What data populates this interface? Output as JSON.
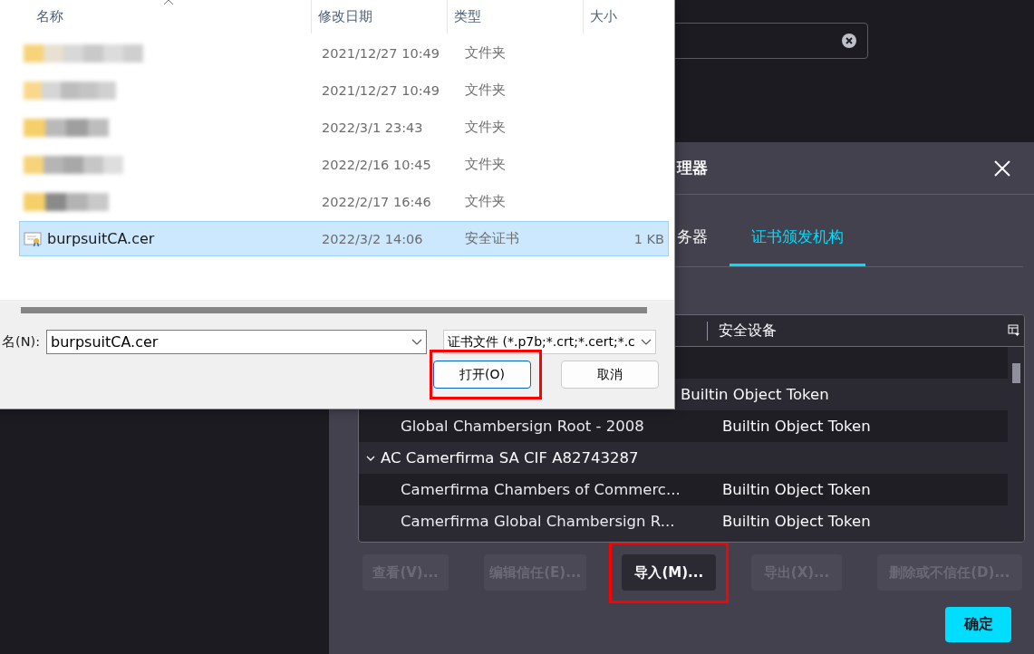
{
  "search_field": {
    "has_clear": true
  },
  "cert_manager": {
    "title": "理器",
    "tabs": [
      {
        "label": "务器",
        "selected": false
      },
      {
        "label": "证书颁发机构",
        "selected": true
      }
    ],
    "table": {
      "columns": [
        "安全设备"
      ],
      "rows": [
        {
          "kind": "blank"
        },
        {
          "kind": "cert",
          "device": "Builtin Object Token"
        },
        {
          "kind": "cert",
          "name": "Global Chambersign Root - 2008",
          "device": "Builtin Object Token"
        },
        {
          "kind": "group",
          "name": "AC Camerfirma SA CIF A82743287",
          "expanded": true
        },
        {
          "kind": "cert",
          "name": "Camerfirma Chambers of Commerc...",
          "device": "Builtin Object Token"
        },
        {
          "kind": "cert",
          "name": "Camerfirma Global Chambersign R...",
          "device": "Builtin Object Token"
        }
      ]
    },
    "buttons": [
      {
        "label": "查看(V)...",
        "disabled": true,
        "highlighted": false
      },
      {
        "label": "编辑信任(E)...",
        "disabled": true,
        "highlighted": false
      },
      {
        "label": "导入(M)...",
        "disabled": false,
        "highlighted": true
      },
      {
        "label": "导出(X)...",
        "disabled": true,
        "highlighted": false
      },
      {
        "label": "删除或不信任(D)...",
        "disabled": true,
        "highlighted": false
      }
    ],
    "ok_button": "确定"
  },
  "file_dialog": {
    "columns": [
      "名称",
      "修改日期",
      "类型",
      "大小"
    ],
    "files": [
      {
        "kind": "folder",
        "modified": "2021/12/27 10:49",
        "type": "文件夹",
        "selected": false
      },
      {
        "kind": "folder",
        "modified": "2021/12/27 10:49",
        "type": "文件夹",
        "selected": false
      },
      {
        "kind": "folder",
        "modified": "2022/3/1 23:43",
        "type": "文件夹",
        "selected": false
      },
      {
        "kind": "folder",
        "modified": "2022/2/16 10:45",
        "type": "文件夹",
        "selected": false
      },
      {
        "kind": "folder",
        "modified": "2022/2/17 16:46",
        "type": "文件夹",
        "selected": false
      },
      {
        "kind": "certificate",
        "name": "burpsuitCA.cer",
        "modified": "2022/3/2 14:06",
        "type": "安全证书",
        "size": "1 KB",
        "selected": true
      }
    ],
    "filename_label": "名(N):",
    "filename": "burpsuitCA.cer",
    "filetype": "证书文件 (*.p7b;*.crt;*.cert;*.c",
    "buttons": [
      {
        "label": "打开(O)",
        "primary": true,
        "highlighted": true
      },
      {
        "label": "取消",
        "primary": false,
        "highlighted": false
      }
    ]
  }
}
